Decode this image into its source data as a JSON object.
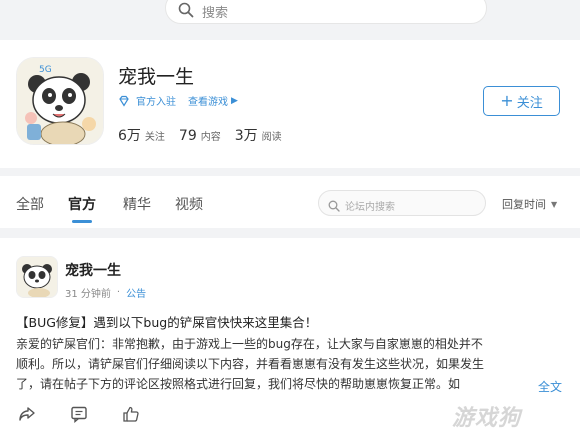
{
  "search": {
    "placeholder": "搜索"
  },
  "profile": {
    "name": "宠我一生",
    "official_badge": "官方入驻",
    "view_game": "查看游戏",
    "follow_label": "关注",
    "stats": [
      {
        "value": "6万",
        "label": "关注"
      },
      {
        "value": "79",
        "label": "内容"
      },
      {
        "value": "3万",
        "label": "阅读"
      }
    ]
  },
  "tabs": [
    {
      "label": "全部"
    },
    {
      "label": "官方"
    },
    {
      "label": "精华"
    },
    {
      "label": "视频"
    }
  ],
  "section_search": {
    "placeholder": "论坛内搜索"
  },
  "sort": {
    "label": "回复时间"
  },
  "post": {
    "author": "宠我一生",
    "time": "31 分钟前",
    "category": "公告",
    "title": "【BUG修复】遇到以下bug的铲屎官快快来这里集合！",
    "body_lines": [
      "亲爱的铲屎官们：非常抱歉，由于游戏上一些的bug存在，让大家与自家崽崽的相处并不",
      "顺利。所以，请铲屎官们仔细阅读以下内容，并看看崽崽有没有发生这些状况，如果发生",
      "了，请在帖子下方的评论区按照格式进行回复，我们将尽快的帮助崽崽恢复正常。如"
    ],
    "more_label": "全文"
  },
  "watermark": "游戏狗",
  "colors": {
    "accent": "#3b8fd6",
    "background": "#f2f3f5"
  }
}
